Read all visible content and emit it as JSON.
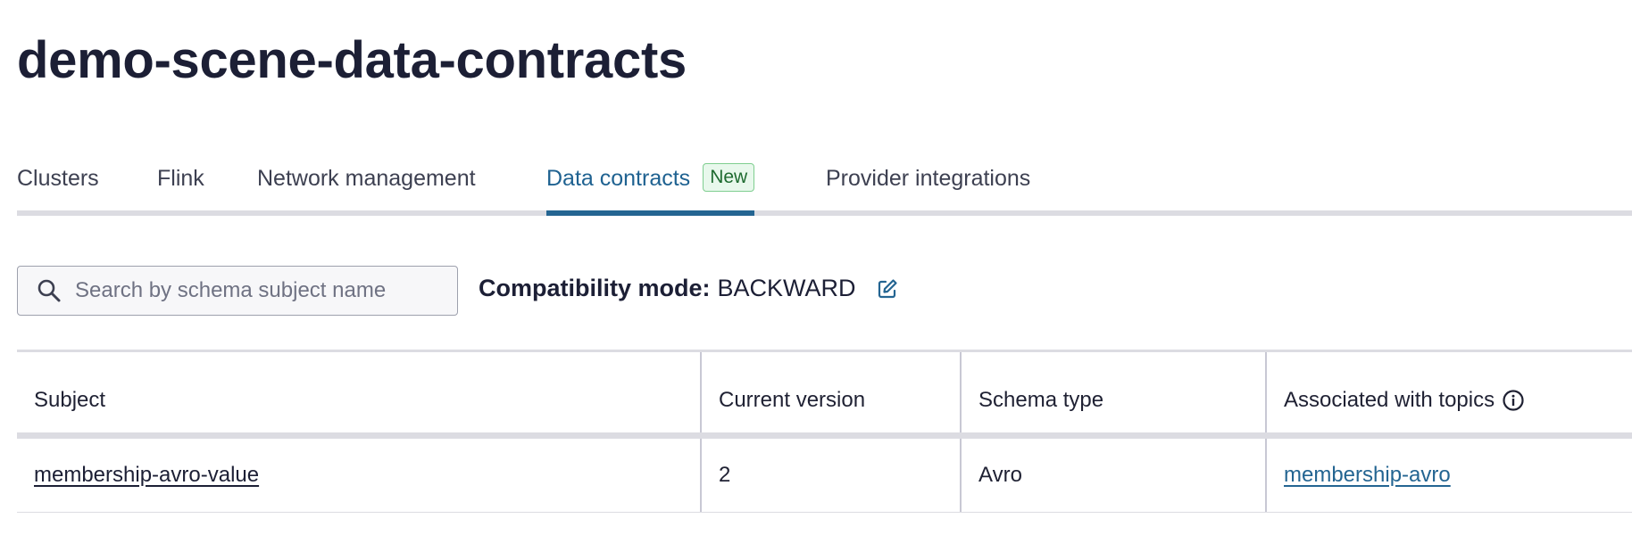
{
  "page": {
    "title": "demo-scene-data-contracts"
  },
  "tabs": [
    {
      "label": "Clusters"
    },
    {
      "label": "Flink"
    },
    {
      "label": "Network management"
    },
    {
      "label": "Data contracts",
      "badge": "New",
      "active": true
    },
    {
      "label": "Provider integrations"
    }
  ],
  "search": {
    "placeholder": "Search by schema subject name",
    "value": "",
    "icon": "search-icon"
  },
  "compatibility": {
    "label": "Compatibility mode:",
    "value": "BACKWARD",
    "icon": "edit-icon"
  },
  "table": {
    "columns": [
      "Subject",
      "Current version",
      "Schema type",
      "Associated with topics"
    ],
    "header_icon": "info-icon",
    "rows": [
      {
        "subject": "membership-avro-value",
        "version": "2",
        "schema_type": "Avro",
        "topics": "membership-avro"
      }
    ]
  },
  "colors": {
    "accent": "#246592",
    "badge_bg": "#e8f8ec",
    "badge_border": "#7fce90",
    "title": "#1c1f35"
  }
}
